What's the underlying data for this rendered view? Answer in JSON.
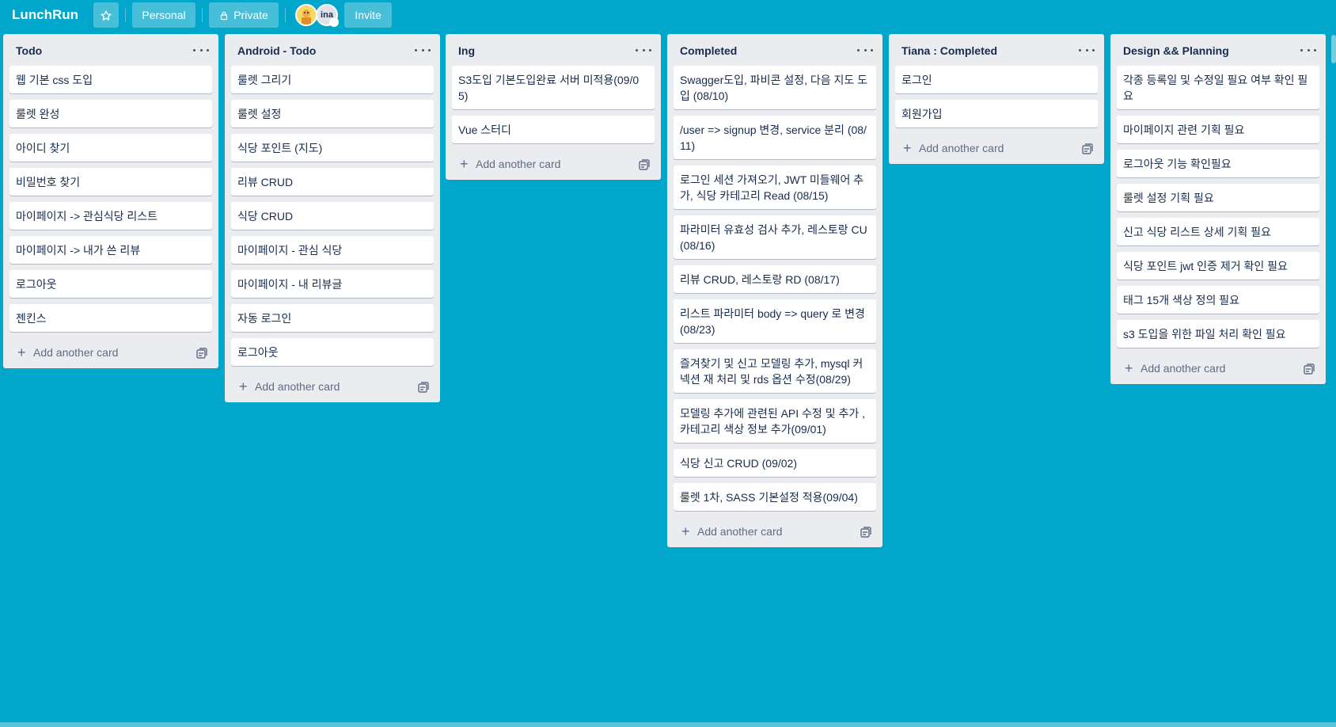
{
  "header": {
    "board_title": "LunchRun",
    "personal_label": "Personal",
    "private_label": "Private",
    "invite_label": "Invite",
    "avatar_initials": "ina"
  },
  "colors": {
    "board_background": "#00A7CB",
    "list_background": "#ebecf0",
    "card_background": "#ffffff"
  },
  "lists": [
    {
      "title": "Todo",
      "add_card_label": "Add another card",
      "cards": [
        "웹 기본 css 도입",
        "룰렛 완성",
        "아이디 찾기",
        "비밀번호 찾기",
        "마이페이지 -> 관심식당 리스트",
        "마이페이지 -> 내가 쓴 리뷰",
        "로그아웃",
        "젠킨스"
      ]
    },
    {
      "title": "Android - Todo",
      "add_card_label": "Add another card",
      "cards": [
        "룰렛 그리기",
        "룰렛 설정",
        "식당 포인트 (지도)",
        "리뷰 CRUD",
        "식당 CRUD",
        "마이페이지 - 관심 식당",
        "마이페이지 - 내 리뷰글",
        "자동 로그인",
        "로그아웃"
      ]
    },
    {
      "title": "Ing",
      "add_card_label": "Add another card",
      "cards": [
        "S3도입 기본도입완료 서버 미적용(09/05)",
        "Vue 스터디"
      ]
    },
    {
      "title": "Completed",
      "add_card_label": "Add another card",
      "cards": [
        "Swagger도입, 파비콘 설정, 다음 지도 도입 (08/10)",
        "/user => signup 변경, service 분리 (08/11)",
        "로그인 세션 가져오기, JWT 미들웨어 추가, 식당 카테고리 Read (08/15)",
        "파라미터 유효성 검사 추가, 레스토랑 CU (08/16)",
        "리뷰 CRUD, 레스토랑 RD (08/17)",
        "리스트 파라미터 body => query 로 변경 (08/23)",
        "즐겨찾기 및 신고 모델링 추가, mysql 커넥션 재 처리 및 rds 옵션 수정(08/29)",
        "모델링 추가에 관련된 API 수정 및 추가 , 카테고리 색상 정보 추가(09/01)",
        "식당 신고 CRUD (09/02)",
        "룰렛 1차, SASS 기본설정 적용(09/04)"
      ]
    },
    {
      "title": "Tiana : Completed",
      "add_card_label": "Add another card",
      "cards": [
        "로그인",
        "회원가입"
      ]
    },
    {
      "title": "Design && Planning",
      "add_card_label": "Add another card",
      "cards": [
        "각종 등록일 및 수정일 필요 여부 확인 필요",
        "마이페이지 관련 기획 필요",
        "로그아웃 기능 확인필요",
        "룰렛 설정 기획 필요",
        "신고 식당 리스트 상세 기획 필요",
        "식당 포인트 jwt 인증 제거 확인 필요",
        "태그 15개 색상 정의 필요",
        "s3 도입을 위한 파일 처리 확인 필요"
      ]
    }
  ]
}
